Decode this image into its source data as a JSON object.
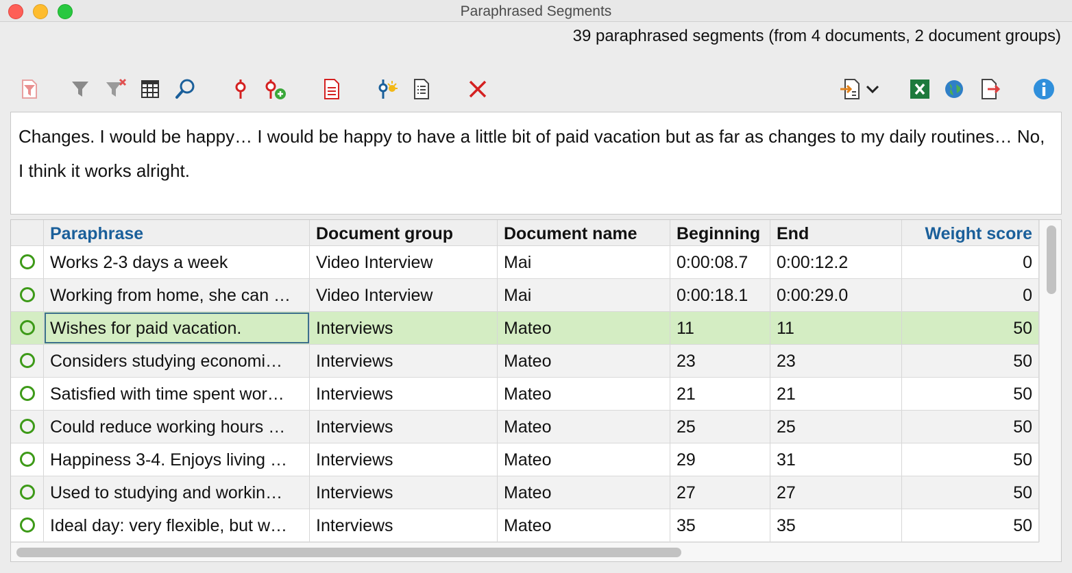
{
  "window": {
    "title": "Paraphrased Segments"
  },
  "summary": "39 paraphrased segments (from 4 documents, 2 document groups)",
  "toolbar": {
    "buttons": [
      {
        "icon": "filter-document-icon"
      },
      {
        "icon": "filter-icon"
      },
      {
        "icon": "clear-filter-icon"
      },
      {
        "icon": "columns-icon"
      },
      {
        "icon": "search-icon"
      },
      {
        "icon": "segment-pin-icon"
      },
      {
        "icon": "add-segment-icon"
      },
      {
        "icon": "document-red-icon"
      },
      {
        "icon": "smart-coding-icon"
      },
      {
        "icon": "list-document-icon"
      },
      {
        "icon": "delete-icon"
      },
      {
        "icon": "import-icon"
      },
      {
        "icon": "chevron-down-icon"
      },
      {
        "icon": "excel-icon"
      },
      {
        "icon": "globe-icon"
      },
      {
        "icon": "export-icon"
      },
      {
        "icon": "info-icon"
      }
    ]
  },
  "preview_text": "Changes. I would be happy… I would be happy to have a little bit of paid vacation but as far as changes to my daily routines… No, I think it works alright.",
  "table": {
    "columns": [
      "Paraphrase",
      "Document group",
      "Document name",
      "Beginning",
      "End",
      "Weight score"
    ],
    "rows": [
      {
        "paraphrase": "Works 2-3 days a week",
        "group": "Video Interview",
        "doc": "Mai",
        "begin": "0:00:08.7",
        "end": "0:00:12.2",
        "weight": "0"
      },
      {
        "paraphrase": "Working from home, she can …",
        "group": "Video Interview",
        "doc": "Mai",
        "begin": "0:00:18.1",
        "end": "0:00:29.0",
        "weight": "0"
      },
      {
        "paraphrase": "Wishes for paid vacation.",
        "group": "Interviews",
        "doc": "Mateo",
        "begin": "11",
        "end": "11",
        "weight": "50"
      },
      {
        "paraphrase": "Considers studying economi…",
        "group": "Interviews",
        "doc": "Mateo",
        "begin": "23",
        "end": "23",
        "weight": "50"
      },
      {
        "paraphrase": "Satisfied with time spent wor…",
        "group": "Interviews",
        "doc": "Mateo",
        "begin": "21",
        "end": "21",
        "weight": "50"
      },
      {
        "paraphrase": "Could reduce working hours …",
        "group": "Interviews",
        "doc": "Mateo",
        "begin": "25",
        "end": "25",
        "weight": "50"
      },
      {
        "paraphrase": "Happiness 3-4. Enjoys living …",
        "group": "Interviews",
        "doc": "Mateo",
        "begin": "29",
        "end": "31",
        "weight": "50"
      },
      {
        "paraphrase": "Used to studying and workin…",
        "group": "Interviews",
        "doc": "Mateo",
        "begin": "27",
        "end": "27",
        "weight": "50"
      },
      {
        "paraphrase": "Ideal day: very flexible, but w…",
        "group": "Interviews",
        "doc": "Mateo",
        "begin": "35",
        "end": "35",
        "weight": "50"
      }
    ]
  }
}
